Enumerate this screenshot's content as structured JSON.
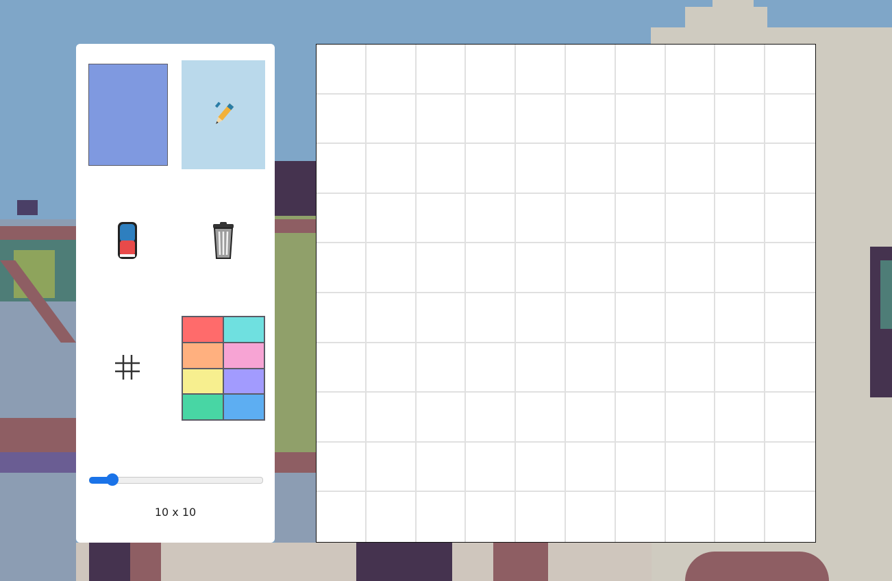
{
  "colors": {
    "current": "#7f99e0",
    "active_tool_bg": "#bad9eb",
    "slider_accent": "#1a73e8"
  },
  "tools": {
    "pencil": {
      "icon": "pencil-icon",
      "active": true
    },
    "eraser": {
      "icon": "eraser-icon"
    },
    "clear": {
      "icon": "trash-icon"
    },
    "grid_toggle": {
      "icon": "grid-icon",
      "glyph": "#"
    }
  },
  "palette": [
    "#ff6b6b",
    "#6fe0e0",
    "#ffb07f",
    "#f7a4d4",
    "#f7ef8f",
    "#a29bfe",
    "#48d6a4",
    "#5daef2"
  ],
  "grid": {
    "rows": 10,
    "cols": 10,
    "slider_fraction": 0.1
  },
  "size_label": "10 x 10"
}
